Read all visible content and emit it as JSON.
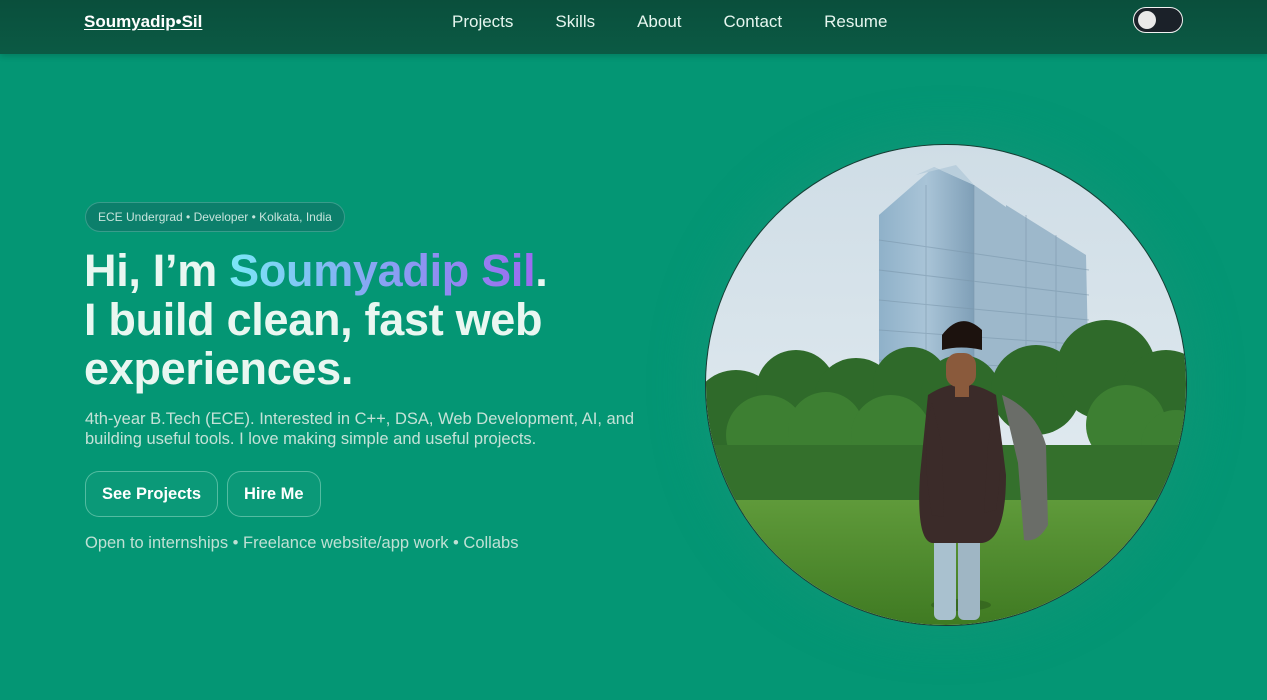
{
  "brand": {
    "label": "Soumyadip•Sil"
  },
  "nav": {
    "items": [
      "Projects",
      "Skills",
      "About",
      "Contact",
      "Resume"
    ]
  },
  "theme_toggle": {
    "icon": "toggle-switch-icon",
    "state": "off"
  },
  "hero": {
    "badge": "ECE Undergrad • Developer • Kolkata, India",
    "headline": {
      "greeting": "Hi, I’m ",
      "name": "Soumyadip Sil",
      "period": ".",
      "line2": "I build clean, fast web",
      "line3": "experiences."
    },
    "subtitle": "4th-year B.Tech (ECE). Interested in C++, DSA, Web Development, AI, and building useful tools. I love making simple and useful projects.",
    "buttons": {
      "projects": "See Projects",
      "hire": "Hire Me"
    },
    "availability": "Open to internships • Freelance website/app work • Collabs"
  },
  "colors": {
    "background": "#049674",
    "nav_background": "#0b5a44",
    "name_gradient": [
      "#7be7f6",
      "#86a8f2",
      "#9c6bf0"
    ]
  }
}
